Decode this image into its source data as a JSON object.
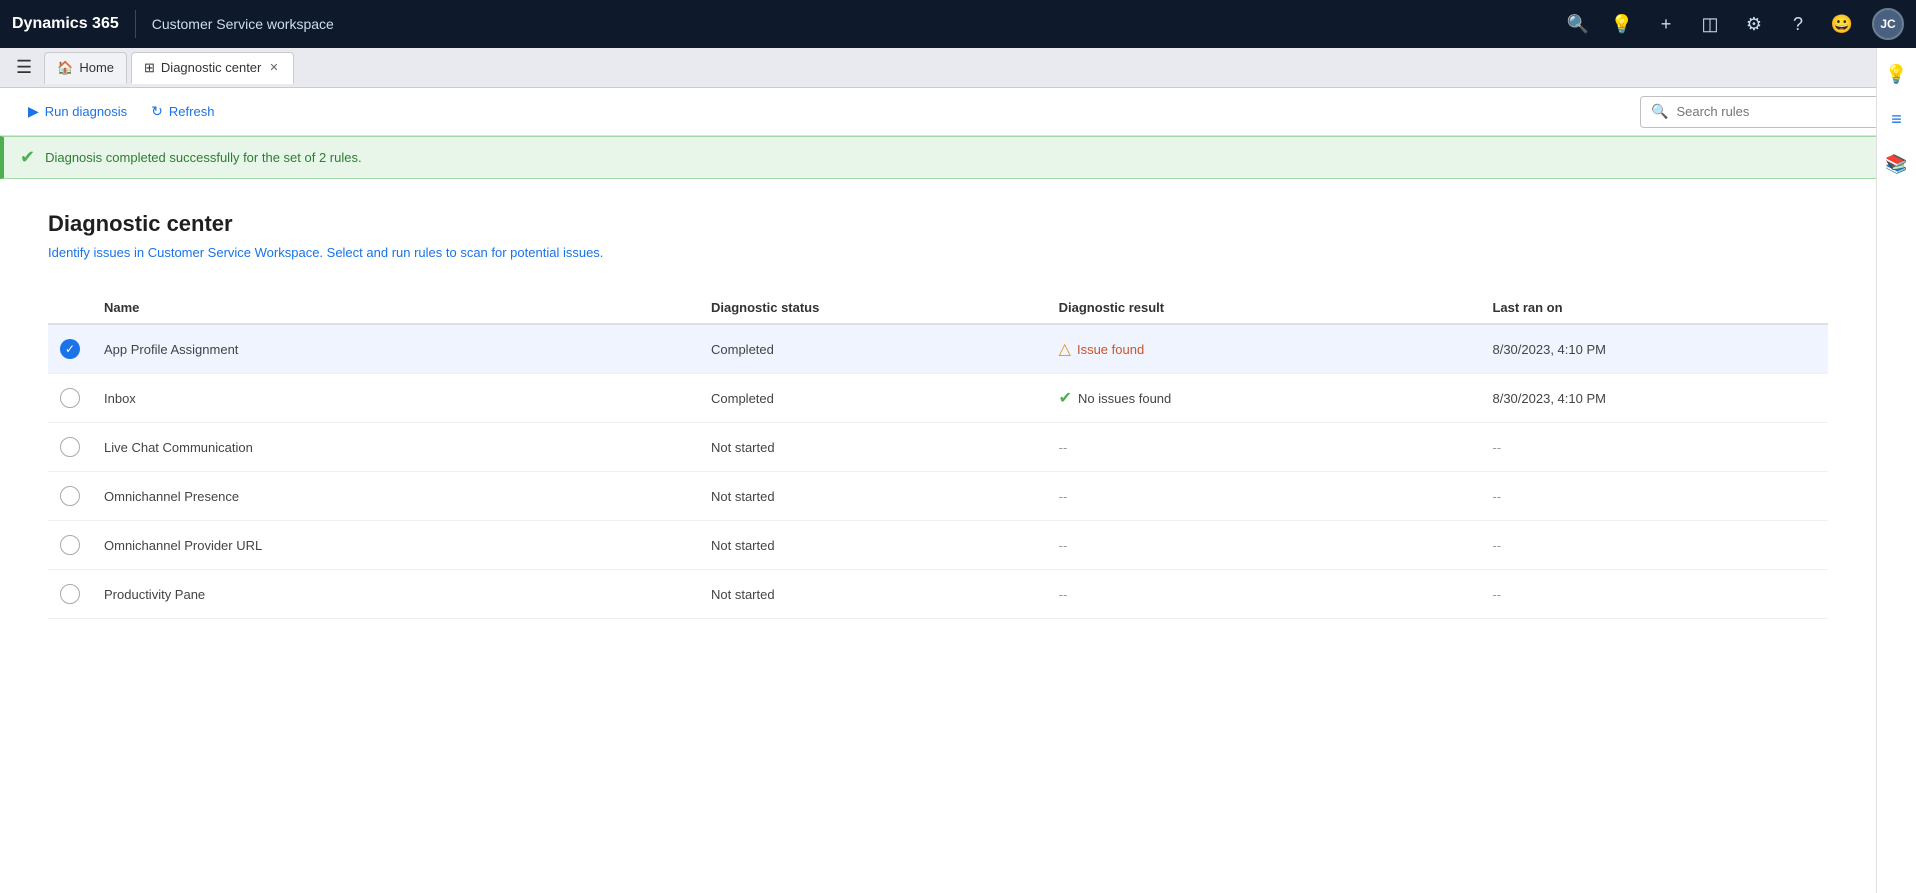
{
  "topbar": {
    "brand": "Dynamics 365",
    "app_name": "Customer Service workspace",
    "icons": [
      "search",
      "lightbulb",
      "plus",
      "filter",
      "settings",
      "help",
      "smiley"
    ],
    "avatar": "JC"
  },
  "tabs": [
    {
      "id": "home",
      "label": "Home",
      "icon": "🏠",
      "active": false
    },
    {
      "id": "diagnostic",
      "label": "Diagnostic center",
      "icon": "⊞",
      "active": true,
      "closeable": true
    }
  ],
  "toolbar": {
    "run_diagnosis_label": "Run diagnosis",
    "refresh_label": "Refresh",
    "search_placeholder": "Search rules"
  },
  "notification": {
    "message": "Diagnosis completed successfully for the set of 2 rules."
  },
  "page": {
    "title": "Diagnostic center",
    "subtitle": "Identify issues in Customer Service Workspace. Select and run rules to scan for potential issues."
  },
  "table": {
    "columns": [
      "Name",
      "Diagnostic status",
      "Diagnostic result",
      "Last ran on"
    ],
    "rows": [
      {
        "name": "App Profile Assignment",
        "status": "Completed",
        "result_type": "issue",
        "result_text": "Issue found",
        "last_ran": "8/30/2023, 4:10 PM",
        "selected": true
      },
      {
        "name": "Inbox",
        "status": "Completed",
        "result_type": "ok",
        "result_text": "No issues found",
        "last_ran": "8/30/2023, 4:10 PM",
        "selected": false
      },
      {
        "name": "Live Chat Communication",
        "status": "Not started",
        "result_type": "dash",
        "result_text": "--",
        "last_ran": "--",
        "selected": false
      },
      {
        "name": "Omnichannel Presence",
        "status": "Not started",
        "result_type": "dash",
        "result_text": "--",
        "last_ran": "--",
        "selected": false
      },
      {
        "name": "Omnichannel Provider URL",
        "status": "Not started",
        "result_type": "dash",
        "result_text": "--",
        "last_ran": "--",
        "selected": false
      },
      {
        "name": "Productivity Pane",
        "status": "Not started",
        "result_type": "dash",
        "result_text": "--",
        "last_ran": "--",
        "selected": false
      }
    ]
  }
}
